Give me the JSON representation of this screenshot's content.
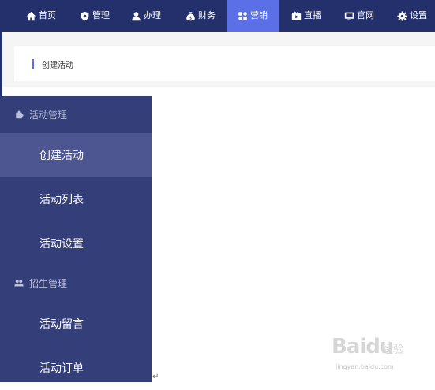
{
  "nav": {
    "items": [
      {
        "label": "首页",
        "icon": "home-icon"
      },
      {
        "label": "管理",
        "icon": "shield-icon"
      },
      {
        "label": "办理",
        "icon": "user-icon"
      },
      {
        "label": "财务",
        "icon": "money-bag-icon"
      },
      {
        "label": "营销",
        "icon": "puzzle-icon",
        "active": true
      },
      {
        "label": "直播",
        "icon": "tv-icon"
      },
      {
        "label": "官网",
        "icon": "monitor-icon"
      },
      {
        "label": "设置",
        "icon": "gear-icon"
      }
    ],
    "active_color": "#5b6fe6",
    "bg_color": "#23306b"
  },
  "breadcrumb": {
    "title": "创建活动"
  },
  "sidebar": {
    "groups": [
      {
        "label": "活动管理",
        "icon": "puzzle-icon",
        "items": [
          {
            "label": "创建活动",
            "active": true
          },
          {
            "label": "活动列表"
          },
          {
            "label": "活动设置"
          }
        ]
      },
      {
        "label": "招生管理",
        "icon": "users-icon",
        "items": [
          {
            "label": "活动留言"
          },
          {
            "label": "活动订单"
          }
        ]
      }
    ],
    "bg_color": "#343f7a",
    "active_bg": "#4d5690"
  },
  "watermark": {
    "brand": "Baidu",
    "cn": "经验",
    "url": "jingyan.baidu.com"
  },
  "return_mark": "↵"
}
